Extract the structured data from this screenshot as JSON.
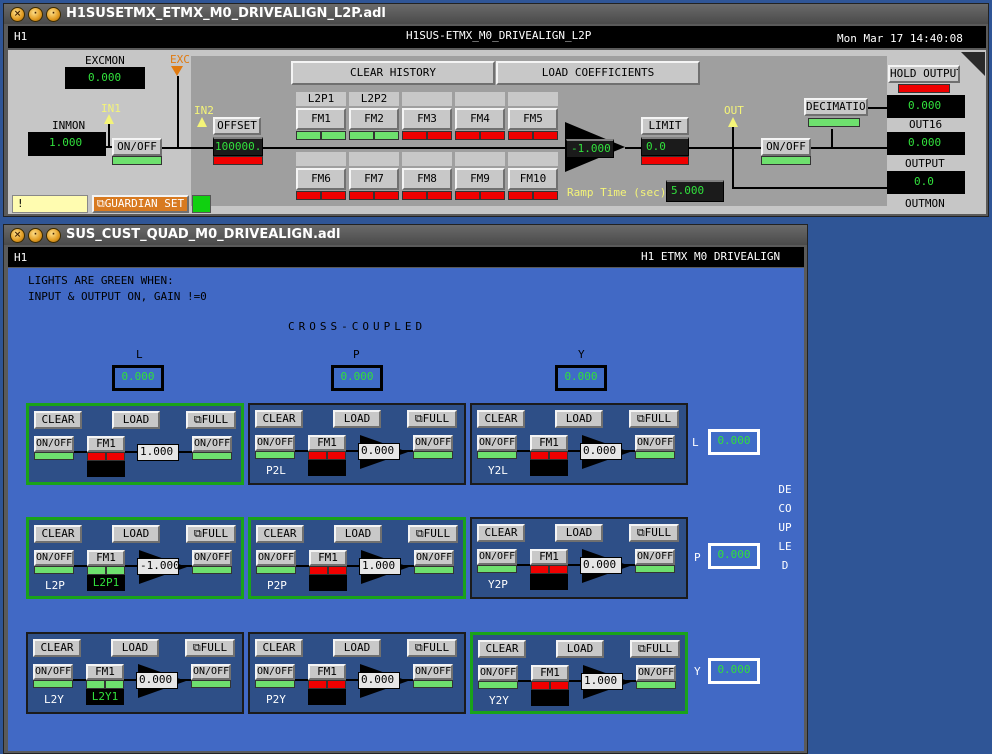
{
  "top_window": {
    "title": "H1SUSETMX_ETMX_M0_DRIVEALIGN_L2P.adl",
    "header_left": "H1",
    "header_center": "H1SUS-ETMX_M0_DRIVEALIGN_L2P",
    "header_right": "Mon Mar 17 14:40:08",
    "excmon_label": "EXCMON",
    "excmon_value": "0.000",
    "exc_label": "EXC",
    "in1_label": "IN1",
    "in2_label": "IN2",
    "inmon_label": "INMON",
    "inmon_value": "1.000",
    "onoff_label": "ON/OFF",
    "offset_label": "OFFSET",
    "offset_value": "100000.",
    "clear_history": "CLEAR HISTORY",
    "load_coefficients": "LOAD COEFFICIENTS",
    "fm_top": [
      "FM1",
      "FM2",
      "FM3",
      "FM4",
      "FM5"
    ],
    "fm_top_names": [
      "L2P1",
      "L2P2",
      "",
      "",
      ""
    ],
    "fm_bottom": [
      "FM6",
      "FM7",
      "FM8",
      "FM9",
      "FM10"
    ],
    "gain_value": "-1.000",
    "limit_label": "LIMIT",
    "limit_value": "0.0",
    "ramp_label": "Ramp Time (sec):",
    "ramp_value": "5.000",
    "out_label": "OUT",
    "onoff2_label": "ON/OFF",
    "decimation_label": "DECIMATION",
    "hold_output": "HOLD OUTPUT",
    "out16_label": "OUT16",
    "out16_value": "0.000",
    "dec_value": "0.000",
    "output_label": "OUTPUT",
    "output_value": "0.0",
    "outmon_label": "OUTMON",
    "excl": "!",
    "guardian_set": "GUARDIAN SET"
  },
  "bottom_window": {
    "title": "SUS_CUST_QUAD_M0_DRIVEALIGN.adl",
    "header_left": "H1",
    "header_right": "H1 ETMX M0 DRIVEALIGN",
    "note_line1": "LIGHTS ARE GREEN WHEN:",
    "note_line2": "INPUT & OUTPUT ON, GAIN !=0",
    "cross_coupled": "CROSS-COUPLED",
    "decoupled": "DECOUPLED",
    "col_labels": [
      "L",
      "P",
      "Y"
    ],
    "row_labels": [
      "L",
      "P",
      "Y"
    ],
    "col_gain_values": [
      "0.000",
      "0.000",
      "0.000"
    ],
    "row_gain_values": [
      "0.000",
      "0.000",
      "0.000"
    ],
    "clear_label": "CLEAR",
    "load_label": "LOAD",
    "full_label": "FULL",
    "onoff_label": "ON/OFF",
    "fm1_label": "FM1",
    "cells": [
      [
        {
          "name": "",
          "fm_name": "",
          "gain": "1.000",
          "active": true,
          "style": "input"
        },
        {
          "name": "P2L",
          "fm_name": "",
          "gain": "0.000",
          "active": false,
          "style": "tri"
        },
        {
          "name": "Y2L",
          "fm_name": "",
          "gain": "0.000",
          "active": false,
          "style": "tri"
        }
      ],
      [
        {
          "name": "L2P",
          "fm_name": "L2P1",
          "gain": "-1.000",
          "active": true,
          "style": "tri"
        },
        {
          "name": "P2P",
          "fm_name": "",
          "gain": "1.000",
          "active": true,
          "style": "tri"
        },
        {
          "name": "Y2P",
          "fm_name": "",
          "gain": "0.000",
          "active": false,
          "style": "tri"
        }
      ],
      [
        {
          "name": "L2Y",
          "fm_name": "L2Y1",
          "gain": "0.000",
          "active": false,
          "style": "tri"
        },
        {
          "name": "P2Y",
          "fm_name": "",
          "gain": "0.000",
          "active": false,
          "style": "tri"
        },
        {
          "name": "Y2Y",
          "fm_name": "",
          "gain": "1.000",
          "active": true,
          "style": "tri"
        }
      ]
    ]
  },
  "colors": {
    "led_on": "#6ee06e",
    "led_off": "#f00000",
    "value_text": "#31e03c",
    "panel_blue": "#3f6cc7",
    "active_border": "#19a319"
  }
}
